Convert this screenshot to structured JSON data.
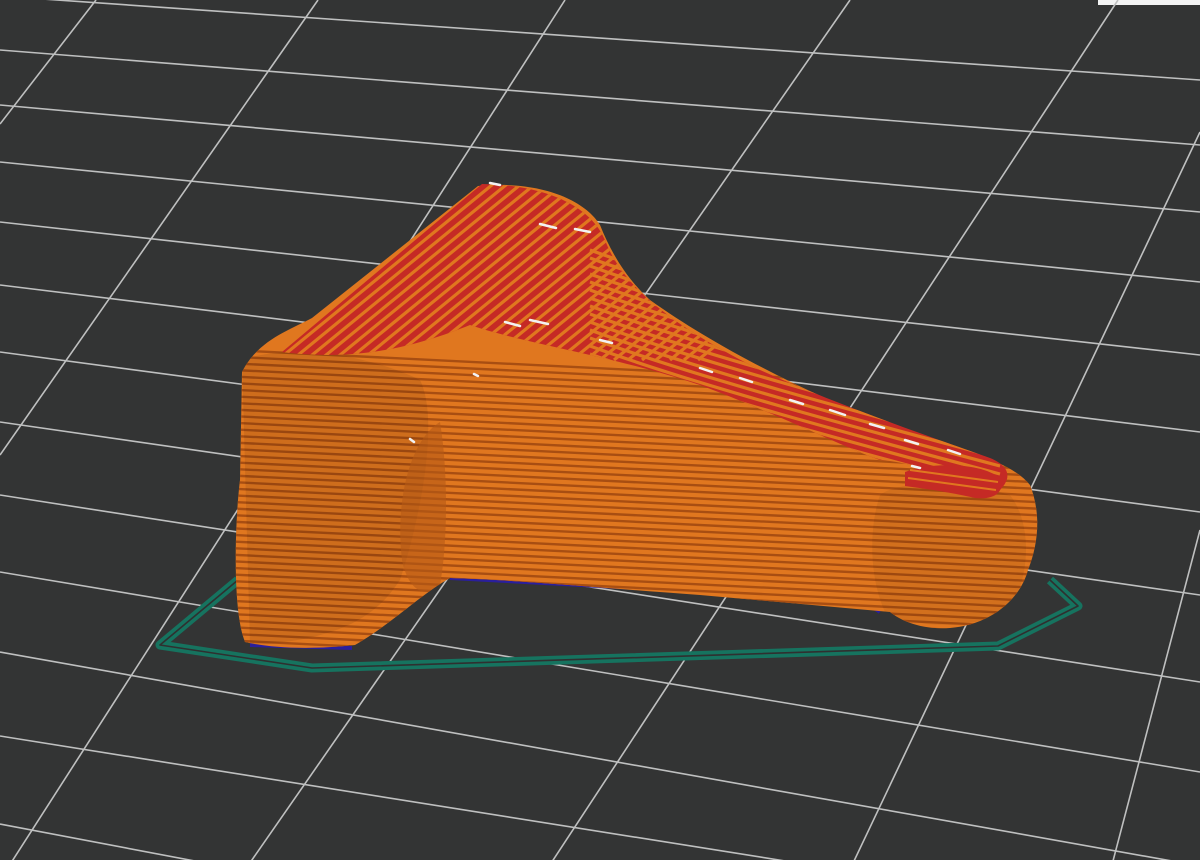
{
  "colors": {
    "background": "#333434",
    "grid_line": "#bfc0c0",
    "skirt": "#16735f",
    "external_perimeter": "#e0771f",
    "perimeter_dark": "#a84e12",
    "top_solid_infill": "#c52a25",
    "overhang_perimeter": "#2a1f9c",
    "gap_fill": "#f2f2f2",
    "panel_edge": "#f3f3f3"
  },
  "preview": {
    "layer_count": 45,
    "features": [
      "skirt",
      "external-perimeter",
      "top-solid-infill",
      "overhang-perimeter",
      "gap-fill"
    ]
  }
}
